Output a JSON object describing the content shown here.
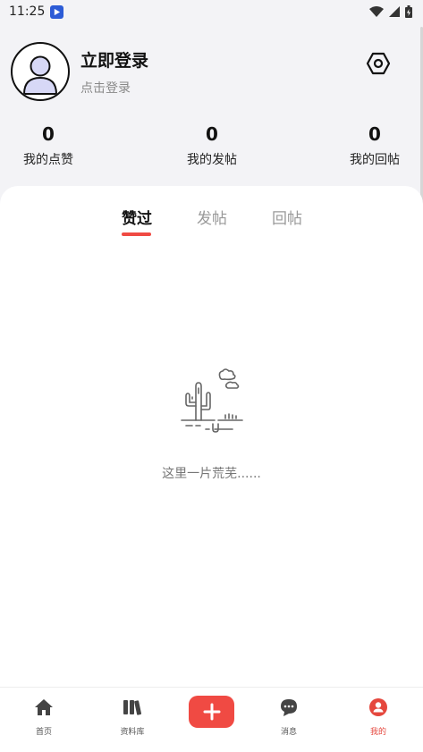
{
  "status_bar": {
    "time": "11:25"
  },
  "profile": {
    "title": "立即登录",
    "subtitle": "点击登录"
  },
  "stats": [
    {
      "count": "0",
      "label": "我的点赞"
    },
    {
      "count": "0",
      "label": "我的发帖"
    },
    {
      "count": "0",
      "label": "我的回帖"
    }
  ],
  "tabs": [
    {
      "label": "赞过",
      "active": true
    },
    {
      "label": "发帖",
      "active": false
    },
    {
      "label": "回帖",
      "active": false
    }
  ],
  "empty_state": {
    "text": "这里一片荒芜......"
  },
  "tab_bar": [
    {
      "label": "首页",
      "icon": "home-icon"
    },
    {
      "label": "资料库",
      "icon": "library-icon"
    },
    {
      "label": "",
      "icon": "plus-icon"
    },
    {
      "label": "消息",
      "icon": "message-icon"
    },
    {
      "label": "我的",
      "icon": "profile-icon",
      "active": true
    }
  ],
  "colors": {
    "accent": "#f04a43",
    "background": "#f3f3f6"
  }
}
